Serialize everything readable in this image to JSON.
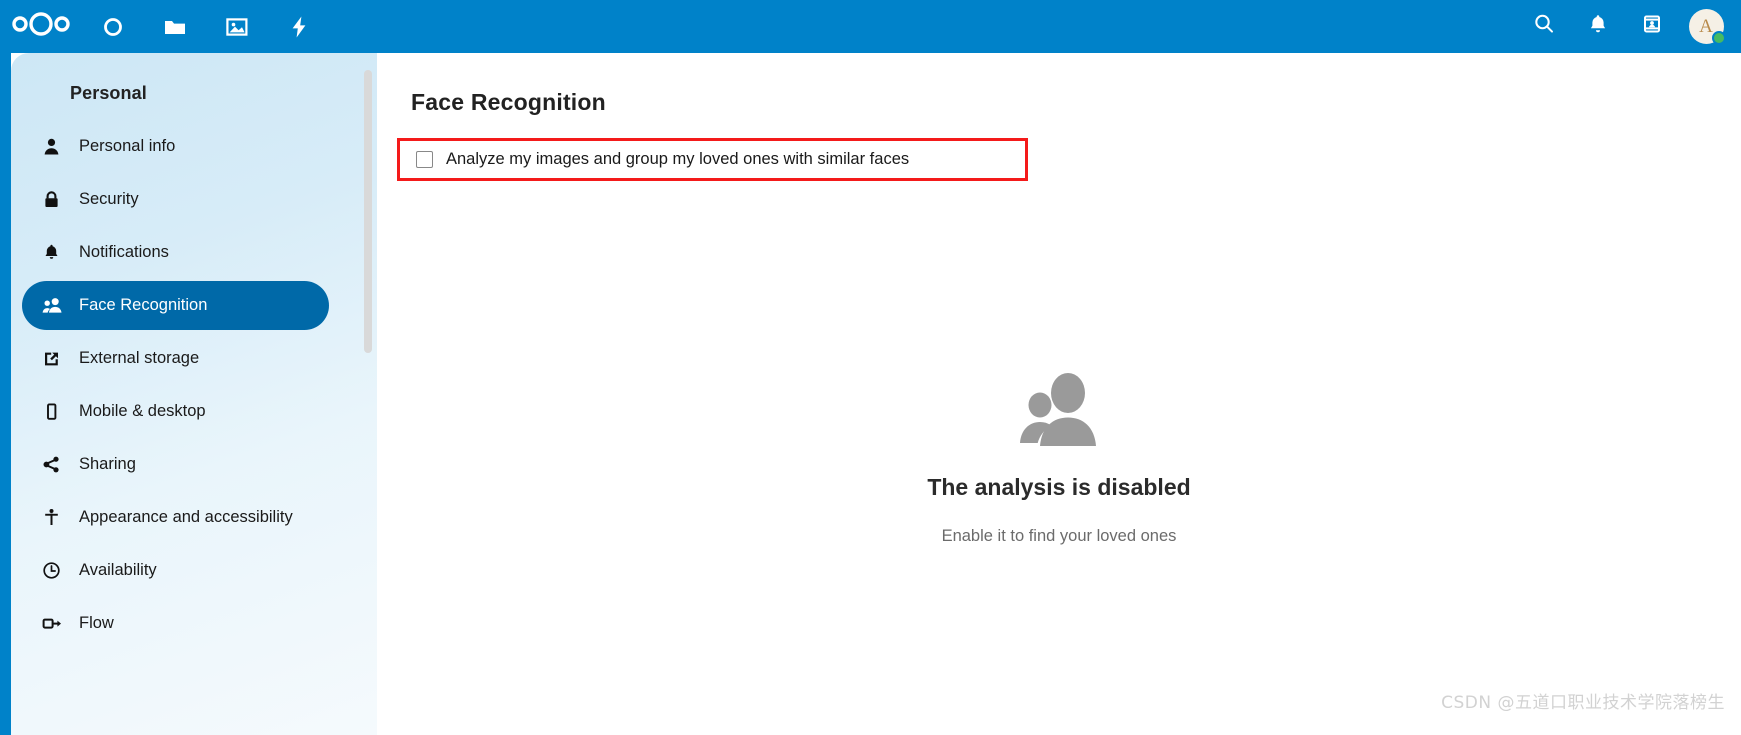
{
  "header": {
    "logo_icon": "nextcloud-logo-icon",
    "apps": [
      {
        "name": "dashboard-app-icon",
        "label": "Dashboard"
      },
      {
        "name": "files-app-icon",
        "label": "Files"
      },
      {
        "name": "photos-app-icon",
        "label": "Photos"
      },
      {
        "name": "activity-app-icon",
        "label": "Activity"
      }
    ],
    "actions": [
      {
        "name": "search-icon",
        "label": "Search"
      },
      {
        "name": "notifications-bell-icon",
        "label": "Notifications"
      },
      {
        "name": "contacts-icon",
        "label": "Contacts"
      }
    ],
    "avatar": {
      "initial": "A",
      "status": "online",
      "status_color": "#46ba61"
    },
    "background_color": "#0082c9"
  },
  "sidebar": {
    "title": "Personal",
    "active_item": "Face Recognition",
    "active_color": "#0069a8",
    "items": [
      {
        "icon": "user-icon",
        "label": "Personal info"
      },
      {
        "icon": "lock-icon",
        "label": "Security"
      },
      {
        "icon": "bell-icon",
        "label": "Notifications"
      },
      {
        "icon": "people-group-icon",
        "label": "Face Recognition"
      },
      {
        "icon": "external-link-icon",
        "label": "External storage"
      },
      {
        "icon": "mobile-device-icon",
        "label": "Mobile & desktop"
      },
      {
        "icon": "share-nodes-icon",
        "label": "Sharing"
      },
      {
        "icon": "accessibility-icon",
        "label": "Appearance and accessibility"
      },
      {
        "icon": "clock-icon",
        "label": "Availability"
      },
      {
        "icon": "flow-arrow-icon",
        "label": "Flow"
      }
    ]
  },
  "main": {
    "page_title": "Face Recognition",
    "checkbox": {
      "label": "Analyze my images and group my loved ones with similar faces",
      "checked": false,
      "highlight_color": "#f41a1a"
    },
    "empty_state": {
      "icon": "two-people-silhouette-icon",
      "title": "The analysis is disabled",
      "subtitle": "Enable it to find your loved ones"
    }
  },
  "watermark": {
    "text": "CSDN @五道口职业技术学院落榜生"
  }
}
